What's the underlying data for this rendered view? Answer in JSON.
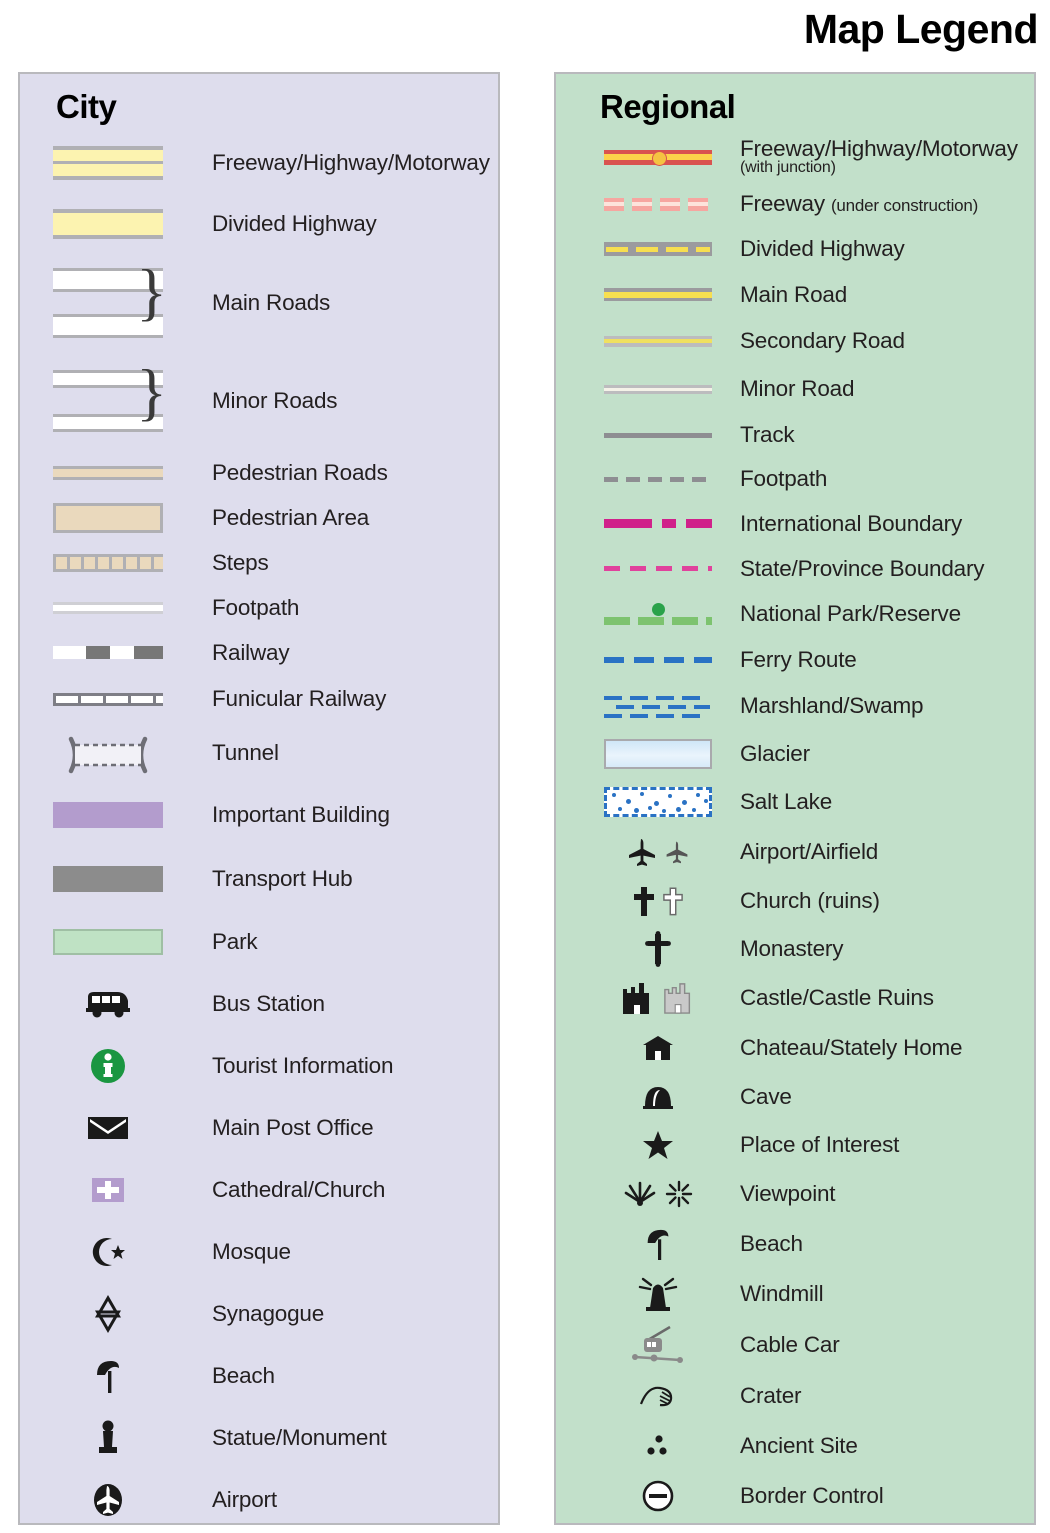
{
  "title": "Map Legend",
  "city": {
    "heading": "City",
    "background": "#dedded",
    "items": [
      {
        "symbol": "freeway-band",
        "label": "Freeway/Highway/Motorway"
      },
      {
        "symbol": "divided-highway-band",
        "label": "Divided Highway"
      },
      {
        "symbol": "main-roads-pair-brace",
        "label": "Main Roads"
      },
      {
        "symbol": "minor-roads-pair-brace",
        "label": "Minor Roads"
      },
      {
        "symbol": "pedestrian-road-band",
        "label": "Pedestrian Roads"
      },
      {
        "symbol": "pedestrian-area-box",
        "label": "Pedestrian Area"
      },
      {
        "symbol": "steps-band",
        "label": "Steps"
      },
      {
        "symbol": "footpath-line",
        "label": "Footpath"
      },
      {
        "symbol": "railway-line",
        "label": "Railway"
      },
      {
        "symbol": "funicular-railway-line",
        "label": "Funicular Railway"
      },
      {
        "symbol": "tunnel-brackets",
        "label": "Tunnel"
      },
      {
        "symbol": "important-building-swatch",
        "label": "Important Building"
      },
      {
        "symbol": "transport-hub-swatch",
        "label": "Transport Hub"
      },
      {
        "symbol": "park-swatch",
        "label": "Park"
      },
      {
        "symbol": "bus-icon",
        "label": "Bus Station"
      },
      {
        "symbol": "information-icon",
        "label": "Tourist Information"
      },
      {
        "symbol": "envelope-icon",
        "label": "Main Post Office"
      },
      {
        "symbol": "cross-square-icon",
        "label": "Cathedral/Church"
      },
      {
        "symbol": "crescent-star-icon",
        "label": "Mosque"
      },
      {
        "symbol": "star-of-david-icon",
        "label": "Synagogue"
      },
      {
        "symbol": "umbrella-icon",
        "label": "Beach"
      },
      {
        "symbol": "monument-icon",
        "label": "Statue/Monument"
      },
      {
        "symbol": "airplane-circle-icon",
        "label": "Airport"
      }
    ],
    "colors": {
      "freeway_fill": "#fcf3b0",
      "pedestrian_fill": "#ead9bd",
      "important_building": "#b39ccd",
      "transport_hub": "#8c8c8c",
      "park": "#bfe2c4",
      "information": "#1a9641"
    }
  },
  "regional": {
    "heading": "Regional",
    "background": "#c2e0ca",
    "items": [
      {
        "symbol": "freeway-junction-line",
        "label": "Freeway/Highway/Motorway",
        "sublabel": "(with junction)"
      },
      {
        "symbol": "freeway-construction-line",
        "label": "Freeway",
        "inline_note": "(under construction)"
      },
      {
        "symbol": "divided-highway-line",
        "label": "Divided Highway"
      },
      {
        "symbol": "main-road-line",
        "label": "Main Road"
      },
      {
        "symbol": "secondary-road-line",
        "label": "Secondary Road"
      },
      {
        "symbol": "minor-road-line",
        "label": "Minor Road"
      },
      {
        "symbol": "track-line",
        "label": "Track"
      },
      {
        "symbol": "footpath-dashed-line",
        "label": "Footpath"
      },
      {
        "symbol": "international-boundary-line",
        "label": "International Boundary"
      },
      {
        "symbol": "state-boundary-line",
        "label": "State/Province Boundary"
      },
      {
        "symbol": "national-park-line",
        "label": "National Park/Reserve"
      },
      {
        "symbol": "ferry-route-line",
        "label": "Ferry Route"
      },
      {
        "symbol": "marshland-pattern",
        "label": "Marshland/Swamp"
      },
      {
        "symbol": "glacier-swatch",
        "label": "Glacier"
      },
      {
        "symbol": "salt-lake-pattern",
        "label": "Salt Lake"
      },
      {
        "symbol": "airplane-icon-pair",
        "label": "Airport/Airfield"
      },
      {
        "symbol": "cross-pair-icon",
        "label": "Church (ruins)"
      },
      {
        "symbol": "monastery-cross-icon",
        "label": "Monastery"
      },
      {
        "symbol": "castle-icon-pair",
        "label": "Castle/Castle Ruins"
      },
      {
        "symbol": "chateau-icon",
        "label": "Chateau/Stately Home"
      },
      {
        "symbol": "cave-icon",
        "label": "Cave"
      },
      {
        "symbol": "star-icon",
        "label": "Place of Interest"
      },
      {
        "symbol": "viewpoint-icon-pair",
        "label": "Viewpoint"
      },
      {
        "symbol": "umbrella-icon",
        "label": "Beach"
      },
      {
        "symbol": "windmill-icon",
        "label": "Windmill"
      },
      {
        "symbol": "cable-car-icon",
        "label": "Cable Car"
      },
      {
        "symbol": "crater-icon",
        "label": "Crater"
      },
      {
        "symbol": "ancient-site-icon",
        "label": "Ancient Site"
      },
      {
        "symbol": "border-control-icon",
        "label": "Border Control"
      }
    ],
    "colors": {
      "freeway_red": "#d9534f",
      "freeway_yellow": "#fcd34a",
      "main_road_yellow": "#f7df50",
      "international_boundary": "#d0218a",
      "state_boundary": "#e0429c",
      "national_park_green": "#7dc36f",
      "ferry_blue": "#2a72c4",
      "glacier_blue": "#cfe6f7"
    }
  }
}
